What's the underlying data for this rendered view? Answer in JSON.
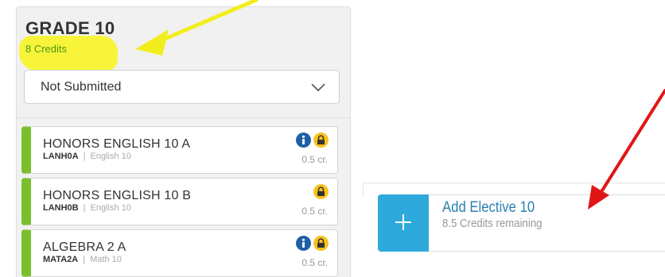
{
  "grade": {
    "title": "GRADE 10",
    "credits": "8 Credits",
    "highlight_color": "#f7f43a"
  },
  "status_dropdown": {
    "selected": "Not Submitted",
    "icon": "chevron-down-icon"
  },
  "courses": [
    {
      "name": "HONORS ENGLISH 10 A",
      "code": "LANH0A",
      "separator": "|",
      "subject": "English 10",
      "credit": "0.5 cr.",
      "has_info": true,
      "locked": true
    },
    {
      "name": "HONORS ENGLISH 10 B",
      "code": "LANH0B",
      "separator": "|",
      "subject": "English 10",
      "credit": "0.5 cr.",
      "has_info": false,
      "locked": true
    },
    {
      "name": "ALGEBRA 2 A",
      "code": "MATA2A",
      "separator": "|",
      "subject": "Math 10",
      "credit": "0.5 cr.",
      "has_info": true,
      "locked": true
    }
  ],
  "elective": {
    "title": "Add Elective 10",
    "subtitle": "8.5 Credits remaining",
    "button_icon": "plus-icon"
  },
  "colors": {
    "course_accent": "#7bc02c",
    "add_button": "#2ea9dc",
    "info_badge": "#1f5fa8",
    "lock_badge": "#f7c21b",
    "yellow_arrow": "#f2ee1d",
    "red_arrow": "#e01616"
  }
}
